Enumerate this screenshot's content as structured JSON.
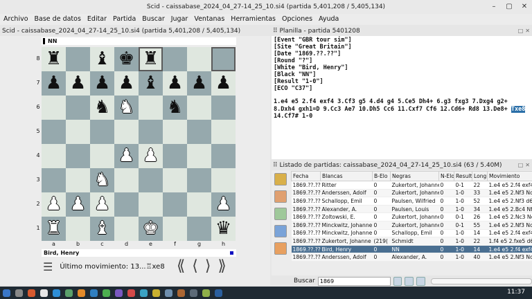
{
  "window": {
    "title": "Scid - caissabase_2024_04_27-14_25_10.si4 (partida 5,401,208 / 5,405,134)"
  },
  "menu": [
    "Archivo",
    "Base de datos",
    "Editar",
    "Partida",
    "Buscar",
    "Jugar",
    "Ventanas",
    "Herramientas",
    "Opciones",
    "Ayuda"
  ],
  "board_panel": {
    "title": "Scid - caissabase_2024_04_27-14_25_10.si4 (partida 5,401,208 / 5,405,134)",
    "black_player": "NN",
    "white_player": "Bird, Henry",
    "last_move_label": "Último movimiento: 13...♖xe8",
    "ranks": [
      "8",
      "7",
      "6",
      "5",
      "4",
      "3",
      "2",
      "1"
    ],
    "files": [
      "a",
      "b",
      "c",
      "d",
      "e",
      "f",
      "g",
      "h"
    ],
    "position": [
      [
        "bR",
        "",
        "bB",
        "bK",
        "bR",
        "",
        "",
        ""
      ],
      [
        "bP",
        "bP",
        "bP",
        "bP",
        "bB",
        "bP",
        "bP",
        "bP"
      ],
      [
        "",
        "",
        "bN",
        "wN",
        "",
        "bN",
        "",
        ""
      ],
      [
        "",
        "",
        "",
        "",
        "",
        "",
        "",
        ""
      ],
      [
        "",
        "",
        "",
        "wP",
        "wP",
        "",
        "",
        ""
      ],
      [
        "",
        "",
        "wN",
        "",
        "",
        "",
        "",
        ""
      ],
      [
        "wP",
        "wP",
        "wP",
        "",
        "",
        "",
        "",
        "wP"
      ],
      [
        "wR",
        "",
        "wB",
        "",
        "wK",
        "",
        "",
        "bQ"
      ]
    ],
    "highlight": [
      "e8",
      "h8"
    ]
  },
  "pgn_panel": {
    "title": "Planilla - partida 5401208",
    "tags": [
      "[Event \"GBR tour sim\"]",
      "[Site \"Great Britain\"]",
      "[Date \"1869.??.??\"]",
      "[Round \"?\"]",
      "[White \"Bird, Henry\"]",
      "[Black \"NN\"]",
      "[Result \"1-0\"]",
      "[ECO \"C37\"]"
    ],
    "moves_before": "1.e4 e5 2.f4 exf4 3.Cf3 g5 4.d4 g4 5.Ce5 Dh4+ 6.g3 fxg3 7.Dxg4 g2+ 8.Dxh4 gxh1=D 9.Cc3 Ae7 10.Dh5 Cc6 11.Cxf7 Cf6 12.Cd6+ Rd8 13.De8+ ",
    "current_move": "Txe8",
    "moves_after": " 14.Cf7# 1-0"
  },
  "game_list": {
    "title": "Listado de partidas: caissabase_2024_04_27-14_25_10.si4 (63 / 5.40M)",
    "columns": [
      "Fecha",
      "Blancas",
      "B-Elo",
      "Negras",
      "N-Elo",
      "Result",
      "Long",
      "Movimiento"
    ],
    "rows": [
      [
        "1869.??.??",
        "Ritter",
        "0",
        "Zukertort, Johanne",
        "0",
        "0-1",
        "22",
        "1.e4 e5 2.f4 exf4"
      ],
      [
        "1869.??.??",
        "Anderssen, Adolf",
        "0",
        "Zukertort, Johanne",
        "0",
        "1-0",
        "33",
        "1.e4 e5 2.Nf3 Nc6"
      ],
      [
        "1869.??.??",
        "Schallopp, Emil",
        "0",
        "Paulsen, Wilfried",
        "0",
        "1-0",
        "52",
        "1.e4 e5 2.Nf3 d6"
      ],
      [
        "1869.??.??",
        "Alexander, A.",
        "0",
        "Paulsen, Louis",
        "0",
        "1-0",
        "34",
        "1.e4 e5 2.Bc4 Nf6"
      ],
      [
        "1869.??.??",
        "Zoltowski, E.",
        "0",
        "Zukertort, Johanne",
        "0",
        "0-1",
        "26",
        "1.e4 e5 2.Nc3 Nc6"
      ],
      [
        "1869.??.??",
        "Minckwitz, Johanne",
        "0",
        "Zukertort, Johanne",
        "0",
        "0-1",
        "55",
        "1.e4 e5 2.Nf3 Nc6"
      ],
      [
        "1869.??.??",
        "Minckwitz, Johanne",
        "0",
        "Schallopp, Emil",
        "0",
        "1-0",
        "14",
        "1.e4 e5 2.f4 exf4"
      ],
      [
        "1869.??.??",
        "Zukertort, Johanne",
        "(219(",
        "Schmidt",
        "0",
        "1-0",
        "22",
        "1.f4 e5 2.fxe5 d6"
      ],
      [
        "1869.??.??",
        "Bird, Henry",
        "0",
        "NN",
        "0",
        "1-0",
        "14",
        "1.e4 e5 2.f4 exf4"
      ],
      [
        "1869.??.??",
        "Anderssen, Adolf",
        "0",
        "Alexander, A.",
        "0",
        "1-0",
        "40",
        "1.e4 e5 2.Nf3 Nc6"
      ]
    ],
    "selected_row": 8,
    "search_label": "Buscar",
    "search_value": "1869"
  },
  "taskbar": {
    "clock": "11:37"
  },
  "colors": {
    "light_square": "#dfe7df",
    "dark_square": "#96a9ad",
    "selected_row": "#4a6f91",
    "taskbar": "#1f2a33"
  }
}
